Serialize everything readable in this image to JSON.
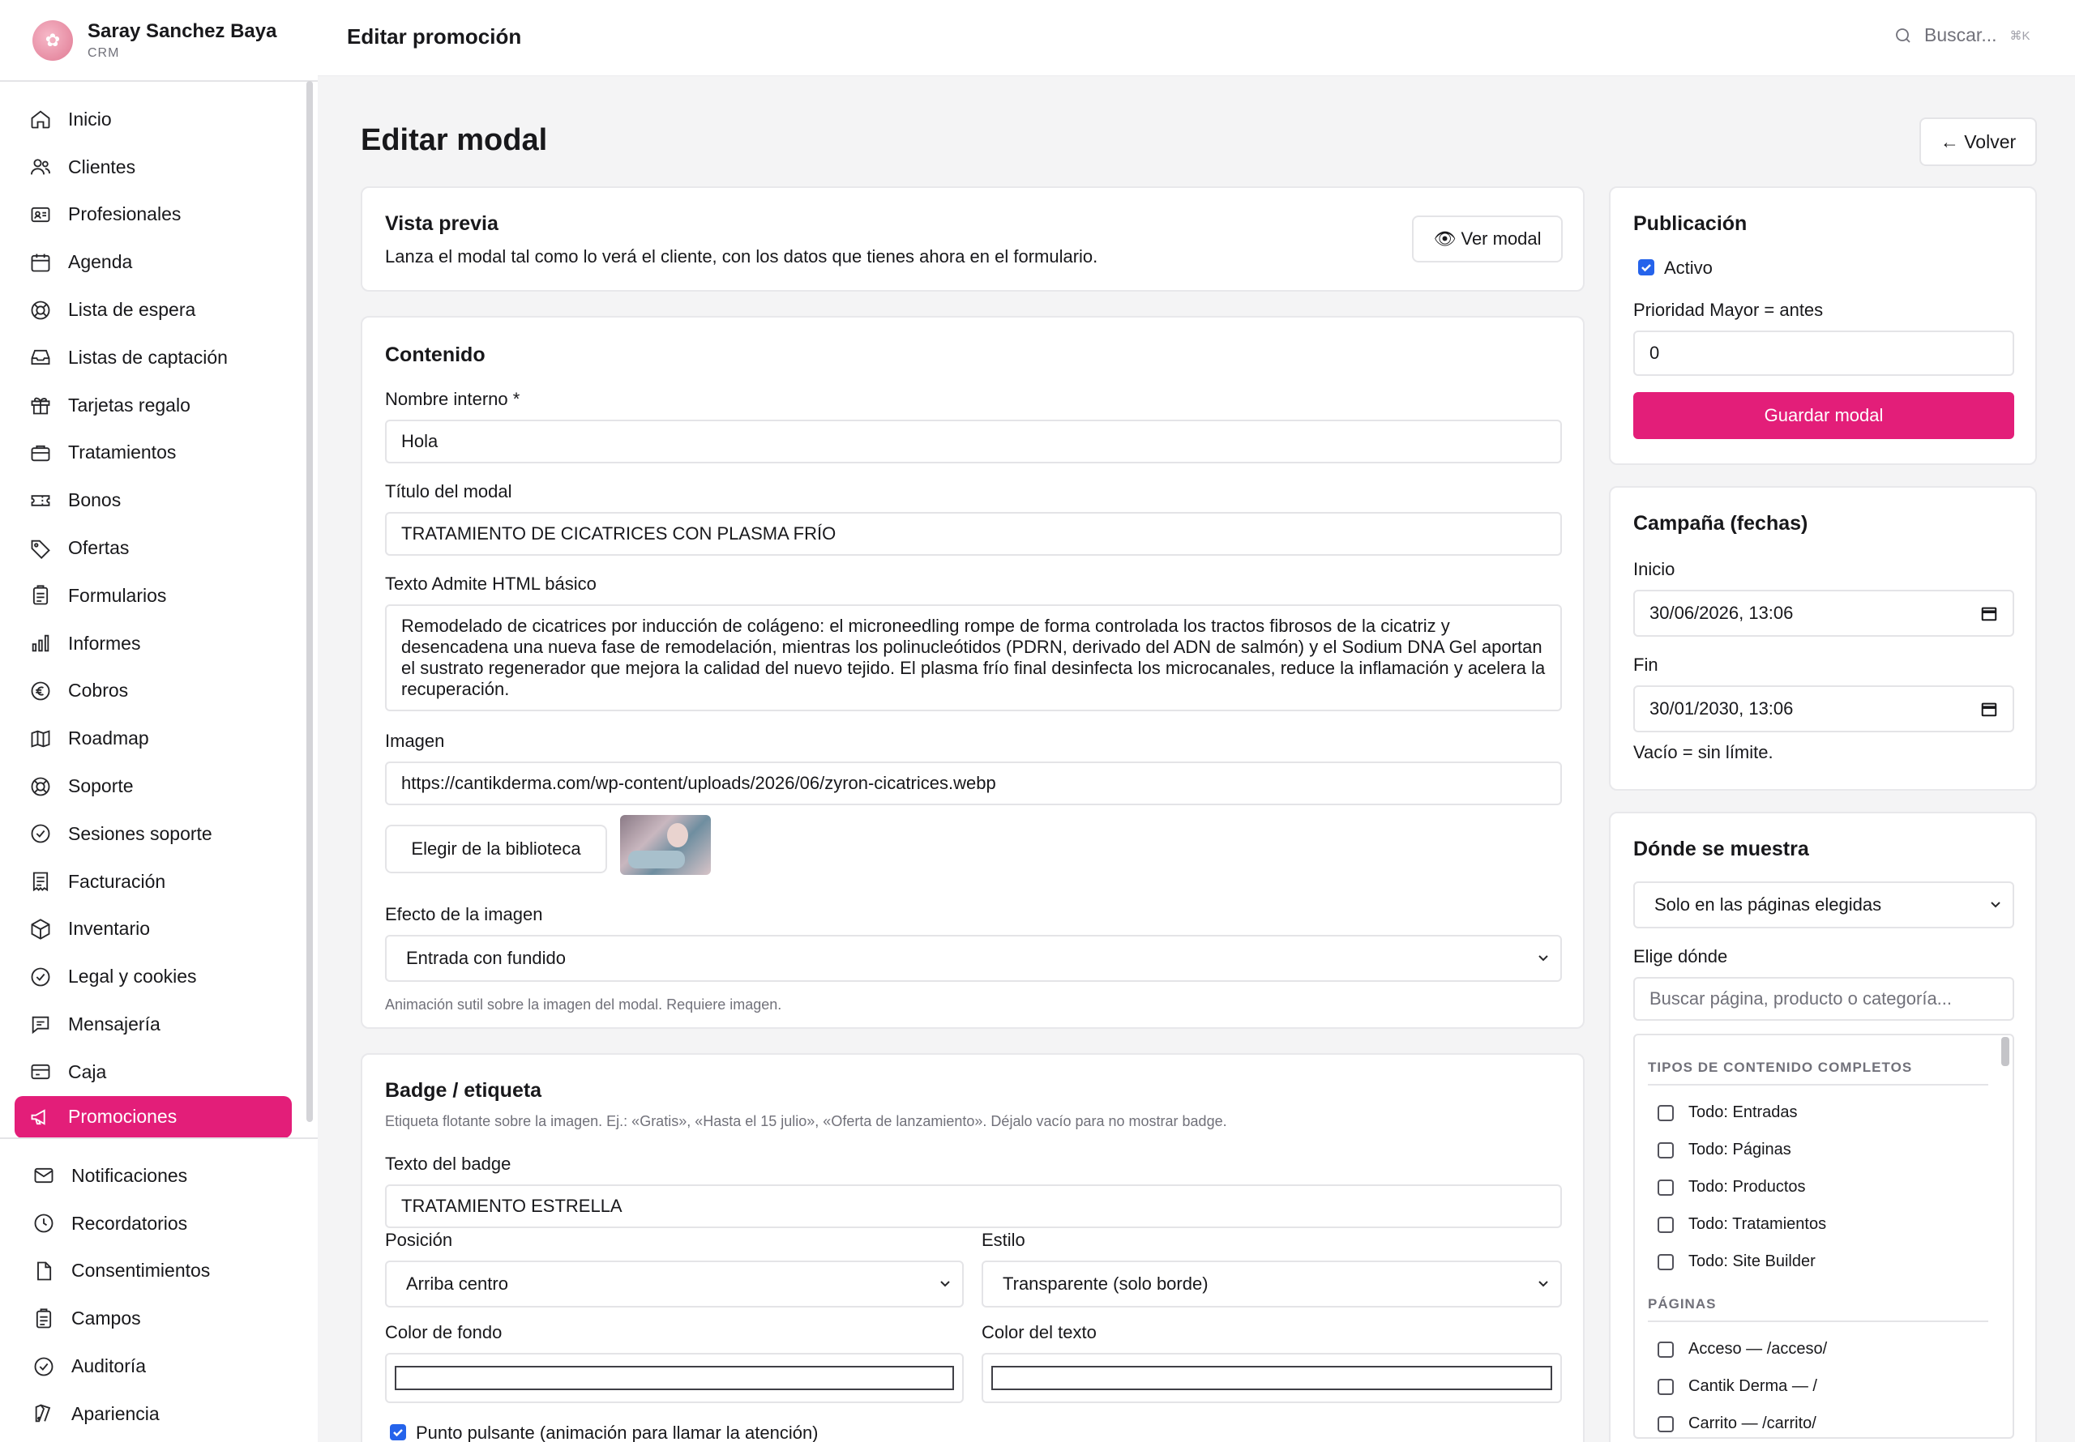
{
  "profile": {
    "name": "Saray Sanchez Baya",
    "subtitle": "CRM"
  },
  "nav": {
    "items": [
      {
        "label": "Inicio",
        "icon": "home-icon"
      },
      {
        "label": "Clientes",
        "icon": "users-icon"
      },
      {
        "label": "Profesionales",
        "icon": "id-card-icon"
      },
      {
        "label": "Agenda",
        "icon": "calendar-icon"
      },
      {
        "label": "Lista de espera",
        "icon": "lifebuoy-icon"
      },
      {
        "label": "Listas de captación",
        "icon": "inbox-icon"
      },
      {
        "label": "Tarjetas regalo",
        "icon": "gift-icon"
      },
      {
        "label": "Tratamientos",
        "icon": "briefcase-icon"
      },
      {
        "label": "Bonos",
        "icon": "ticket-icon"
      },
      {
        "label": "Ofertas",
        "icon": "tag-icon"
      },
      {
        "label": "Formularios",
        "icon": "clipboard-icon"
      },
      {
        "label": "Informes",
        "icon": "bar-chart-icon"
      },
      {
        "label": "Cobros",
        "icon": "euro-icon"
      },
      {
        "label": "Roadmap",
        "icon": "map-icon"
      },
      {
        "label": "Soporte",
        "icon": "lifebuoy-icon"
      },
      {
        "label": "Sesiones soporte",
        "icon": "shield-check-icon"
      },
      {
        "label": "Facturación",
        "icon": "receipt-icon"
      },
      {
        "label": "Inventario",
        "icon": "box-icon"
      },
      {
        "label": "Legal y cookies",
        "icon": "shield-check-icon"
      },
      {
        "label": "Mensajería",
        "icon": "message-icon"
      },
      {
        "label": "Caja",
        "icon": "credit-card-icon"
      },
      {
        "label": "Promociones",
        "icon": "megaphone-icon",
        "active": true
      }
    ],
    "secondary": [
      {
        "label": "Notificaciones",
        "icon": "mail-icon"
      },
      {
        "label": "Recordatorios",
        "icon": "clock-icon"
      },
      {
        "label": "Consentimientos",
        "icon": "file-icon"
      },
      {
        "label": "Campos",
        "icon": "clipboard-icon"
      },
      {
        "label": "Auditoría",
        "icon": "shield-check-icon"
      },
      {
        "label": "Apariencia",
        "icon": "palette-icon"
      }
    ]
  },
  "topbar": {
    "title": "Editar promoción",
    "search_placeholder": "Buscar...",
    "shortcut": "⌘K"
  },
  "page": {
    "title": "Editar modal",
    "back_label": "← Volver"
  },
  "preview": {
    "title": "Vista previa",
    "description": "Lanza el modal tal como lo verá el cliente, con los datos que tienes ahora en el formulario.",
    "button_label": "👁 Ver modal"
  },
  "content": {
    "title": "Contenido",
    "name_label": "Nombre interno *",
    "name_value": "Hola",
    "modal_title_label": "Título del modal",
    "modal_title_value": "TRATAMIENTO DE CICATRICES CON PLASMA FRÍO",
    "text_label": "Texto Admite HTML básico",
    "text_value": "Remodelado de cicatrices por inducción de colágeno: el microneedling rompe de forma controlada los tractos fibrosos de la cicatriz y desencadena una nueva fase de remodelación, mientras los polinucleótidos (PDRN, derivado del ADN de salmón) y el Sodium DNA Gel aportan el sustrato regenerador que mejora la calidad del nuevo tejido. El plasma frío final desinfecta los microcanales, reduce la inflamación y acelera la recuperación.",
    "image_label": "Imagen",
    "image_value": "https://cantikderma.com/wp-content/uploads/2026/06/zyron-cicatrices.webp",
    "library_button": "Elegir de la biblioteca",
    "effect_label": "Efecto de la imagen",
    "effect_value": "Entrada con fundido",
    "effect_hint": "Animación sutil sobre la imagen del modal. Requiere imagen."
  },
  "badge": {
    "title": "Badge / etiqueta",
    "hint": "Etiqueta flotante sobre la imagen. Ej.: «Gratis», «Hasta el 15 julio», «Oferta de lanzamiento». Déjalo vacío para no mostrar badge.",
    "text_label": "Texto del badge",
    "text_value": "TRATAMIENTO ESTRELLA",
    "position_label": "Posición",
    "position_value": "Arriba centro",
    "style_label": "Estilo",
    "style_value": "Transparente (solo borde)",
    "bg_color_label": "Color de fondo",
    "text_color_label": "Color del texto",
    "pulse_label": "Punto pulsante (animación para llamar la atención)",
    "pulse_checked": true
  },
  "publication": {
    "title": "Publicación",
    "active_label": "Activo",
    "active_checked": true,
    "priority_label": "Prioridad Mayor = antes",
    "priority_value": "0",
    "save_label": "Guardar modal"
  },
  "campaign": {
    "title": "Campaña (fechas)",
    "start_label": "Inicio",
    "start_value": "30/06/2026, 13:06",
    "end_label": "Fin",
    "end_value": "30/01/2030, 13:06",
    "hint": "Vacío = sin límite."
  },
  "where": {
    "title": "Dónde se muestra",
    "mode_value": "Solo en las páginas elegidas",
    "choose_label": "Elige dónde",
    "search_placeholder": "Buscar página, producto o categoría...",
    "group1_title": "TIPOS DE CONTENIDO COMPLETOS",
    "group1": [
      "Todo: Entradas",
      "Todo: Páginas",
      "Todo: Productos",
      "Todo: Tratamientos",
      "Todo: Site Builder"
    ],
    "group2_title": "PÁGINAS",
    "group2": [
      "Acceso — /acceso/",
      "Cantik Derma — /",
      "Carrito — /carrito/"
    ]
  },
  "colors": {
    "accent": "#e31e79",
    "checkbox": "#2563eb"
  }
}
